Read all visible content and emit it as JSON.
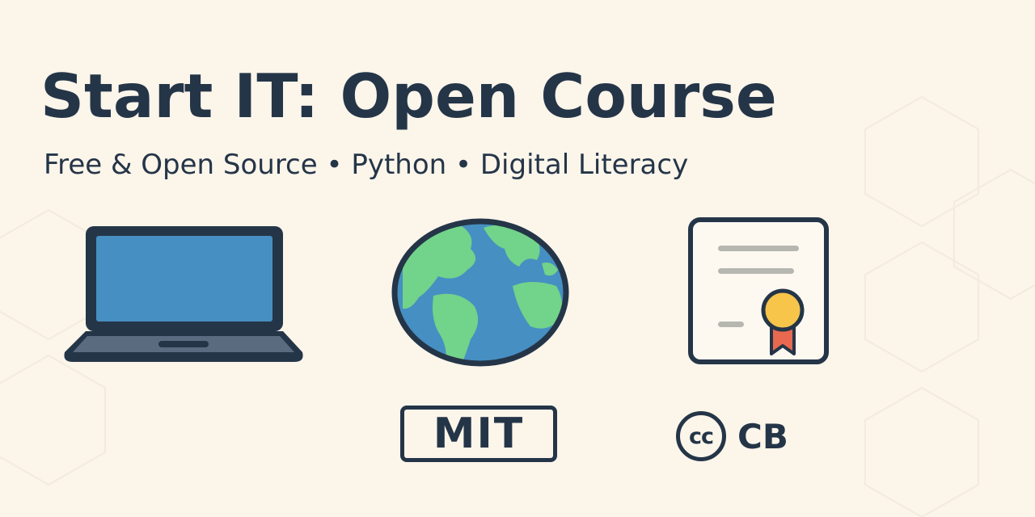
{
  "title": "Start IT: Open Course",
  "subtitle": "Free & Open Source • Python • Digital Literacy",
  "icons": {
    "laptop": "laptop-icon",
    "globe": "globe-icon",
    "certificate": "certificate-icon",
    "creative_commons": "creative-commons-icon"
  },
  "licenses": {
    "mit_label": "MIT",
    "cc_symbol": "cc",
    "cc_label": "CB"
  },
  "colors": {
    "background": "#fbf5ea",
    "ink": "#253548",
    "screen_blue": "#468fc2",
    "land_green": "#72d38a",
    "medal_gold": "#f6c54a",
    "ribbon_red": "#e8694f"
  }
}
